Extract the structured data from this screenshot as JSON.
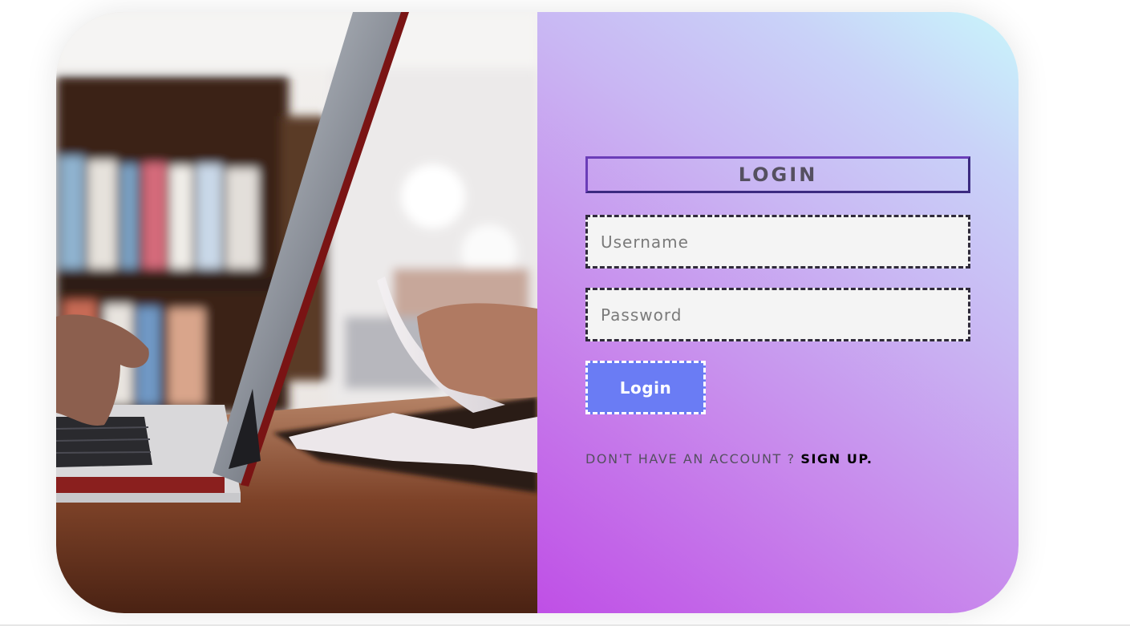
{
  "login_form": {
    "title": "LOGIN",
    "username_placeholder": "Username",
    "username_value": "",
    "password_placeholder": "Password",
    "password_value": "",
    "submit_label": "Login",
    "signup_prompt": "DON'T HAVE AN ACCOUNT ? ",
    "signup_link": "SIGN UP."
  },
  "hero_image": {
    "icon": "laptop-and-book-photo"
  },
  "colors": {
    "panel_gradient_start": "#bf4fe6",
    "panel_gradient_end": "#c9f6fb",
    "button": "#6a7cf4",
    "title_border": "#6b3db8"
  }
}
